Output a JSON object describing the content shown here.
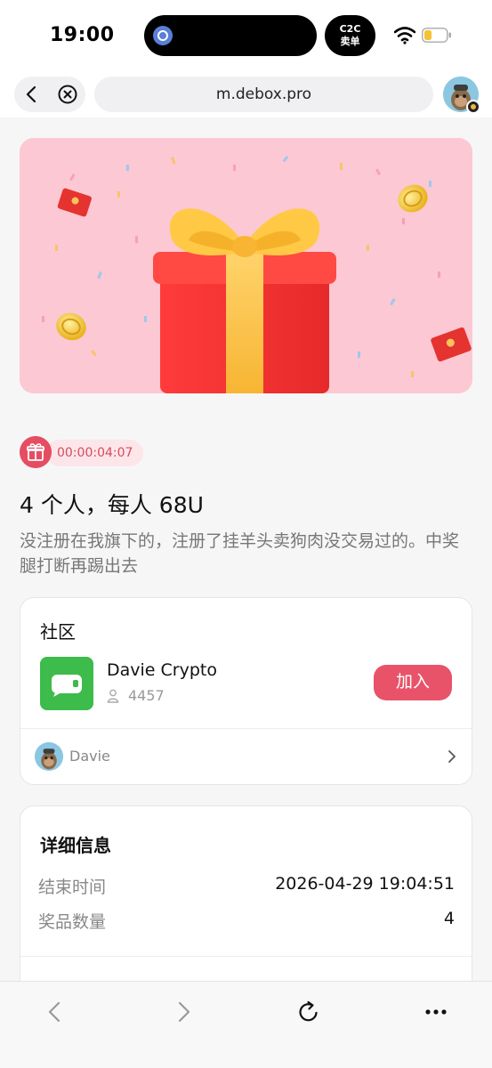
{
  "status_bar": {
    "time": "19:00",
    "c2c_line1": "C2C",
    "c2c_line2": "卖单",
    "icons": [
      "app-indicator-icon",
      "wifi-icon",
      "battery-icon"
    ],
    "battery_color": "#f5c232"
  },
  "browser": {
    "url": "m.debox.pro",
    "icons": [
      "back-arrow-icon",
      "close-circle-icon",
      "profile-avatar"
    ]
  },
  "banner": {
    "background_color": "#fcc8d3",
    "illustration": "gift-box-with-coins-and-red-envelopes"
  },
  "giveaway": {
    "countdown": "00:00:04:07",
    "title": "4 个人，每人 68U",
    "description": "没注册在我旗下的，注册了挂羊头卖狗肉没交易过的。中奖腿打断再踢出去",
    "accent_color": "#e8536a"
  },
  "community": {
    "section_title": "社区",
    "group_name": "Davie Crypto",
    "member_count": "4457",
    "join_label": "加入",
    "owner_name": "Davie",
    "group_icon_color": "#3dbb4b"
  },
  "details": {
    "section_title": "详细信息",
    "rows": [
      {
        "label": "结束时间",
        "value": "2026-04-29 19:04:51"
      },
      {
        "label": "奖品数量",
        "value": "4"
      }
    ]
  },
  "toolbar": {
    "icons": [
      "back-icon",
      "forward-icon",
      "refresh-icon",
      "more-icon"
    ]
  }
}
